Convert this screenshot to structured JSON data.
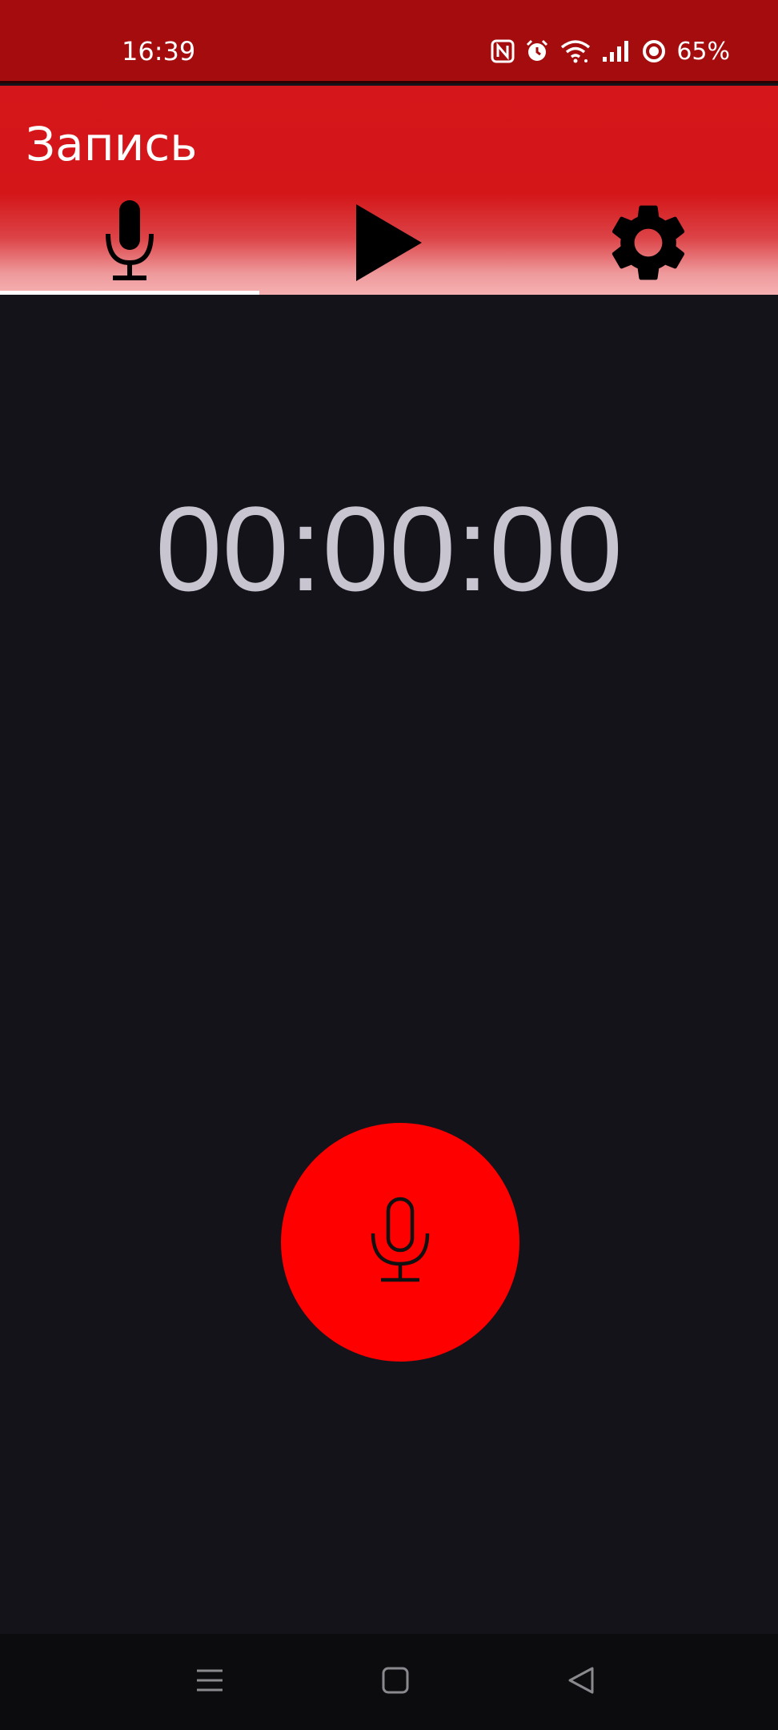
{
  "status_bar": {
    "time": "16:39",
    "battery": "65%",
    "icons": [
      "nfc-icon",
      "alarm-icon",
      "wifi-icon",
      "signal-icon",
      "battery-icon"
    ]
  },
  "app_bar": {
    "title": "Запись",
    "tabs": [
      {
        "icon": "microphone-icon",
        "selected": true
      },
      {
        "icon": "play-icon",
        "selected": false
      },
      {
        "icon": "settings-gear-icon",
        "selected": false
      }
    ]
  },
  "recorder": {
    "timer": "00:00:00"
  },
  "record_button": {
    "icon": "microphone-icon",
    "color": "#fe0000"
  },
  "nav_bar": {
    "buttons": [
      "menu-icon",
      "home-icon",
      "back-icon"
    ]
  },
  "colors": {
    "status_bar": "#a50c0e",
    "app_bar": "#d5171b",
    "background": "#15131a",
    "timer_text": "#c8c5d0"
  }
}
